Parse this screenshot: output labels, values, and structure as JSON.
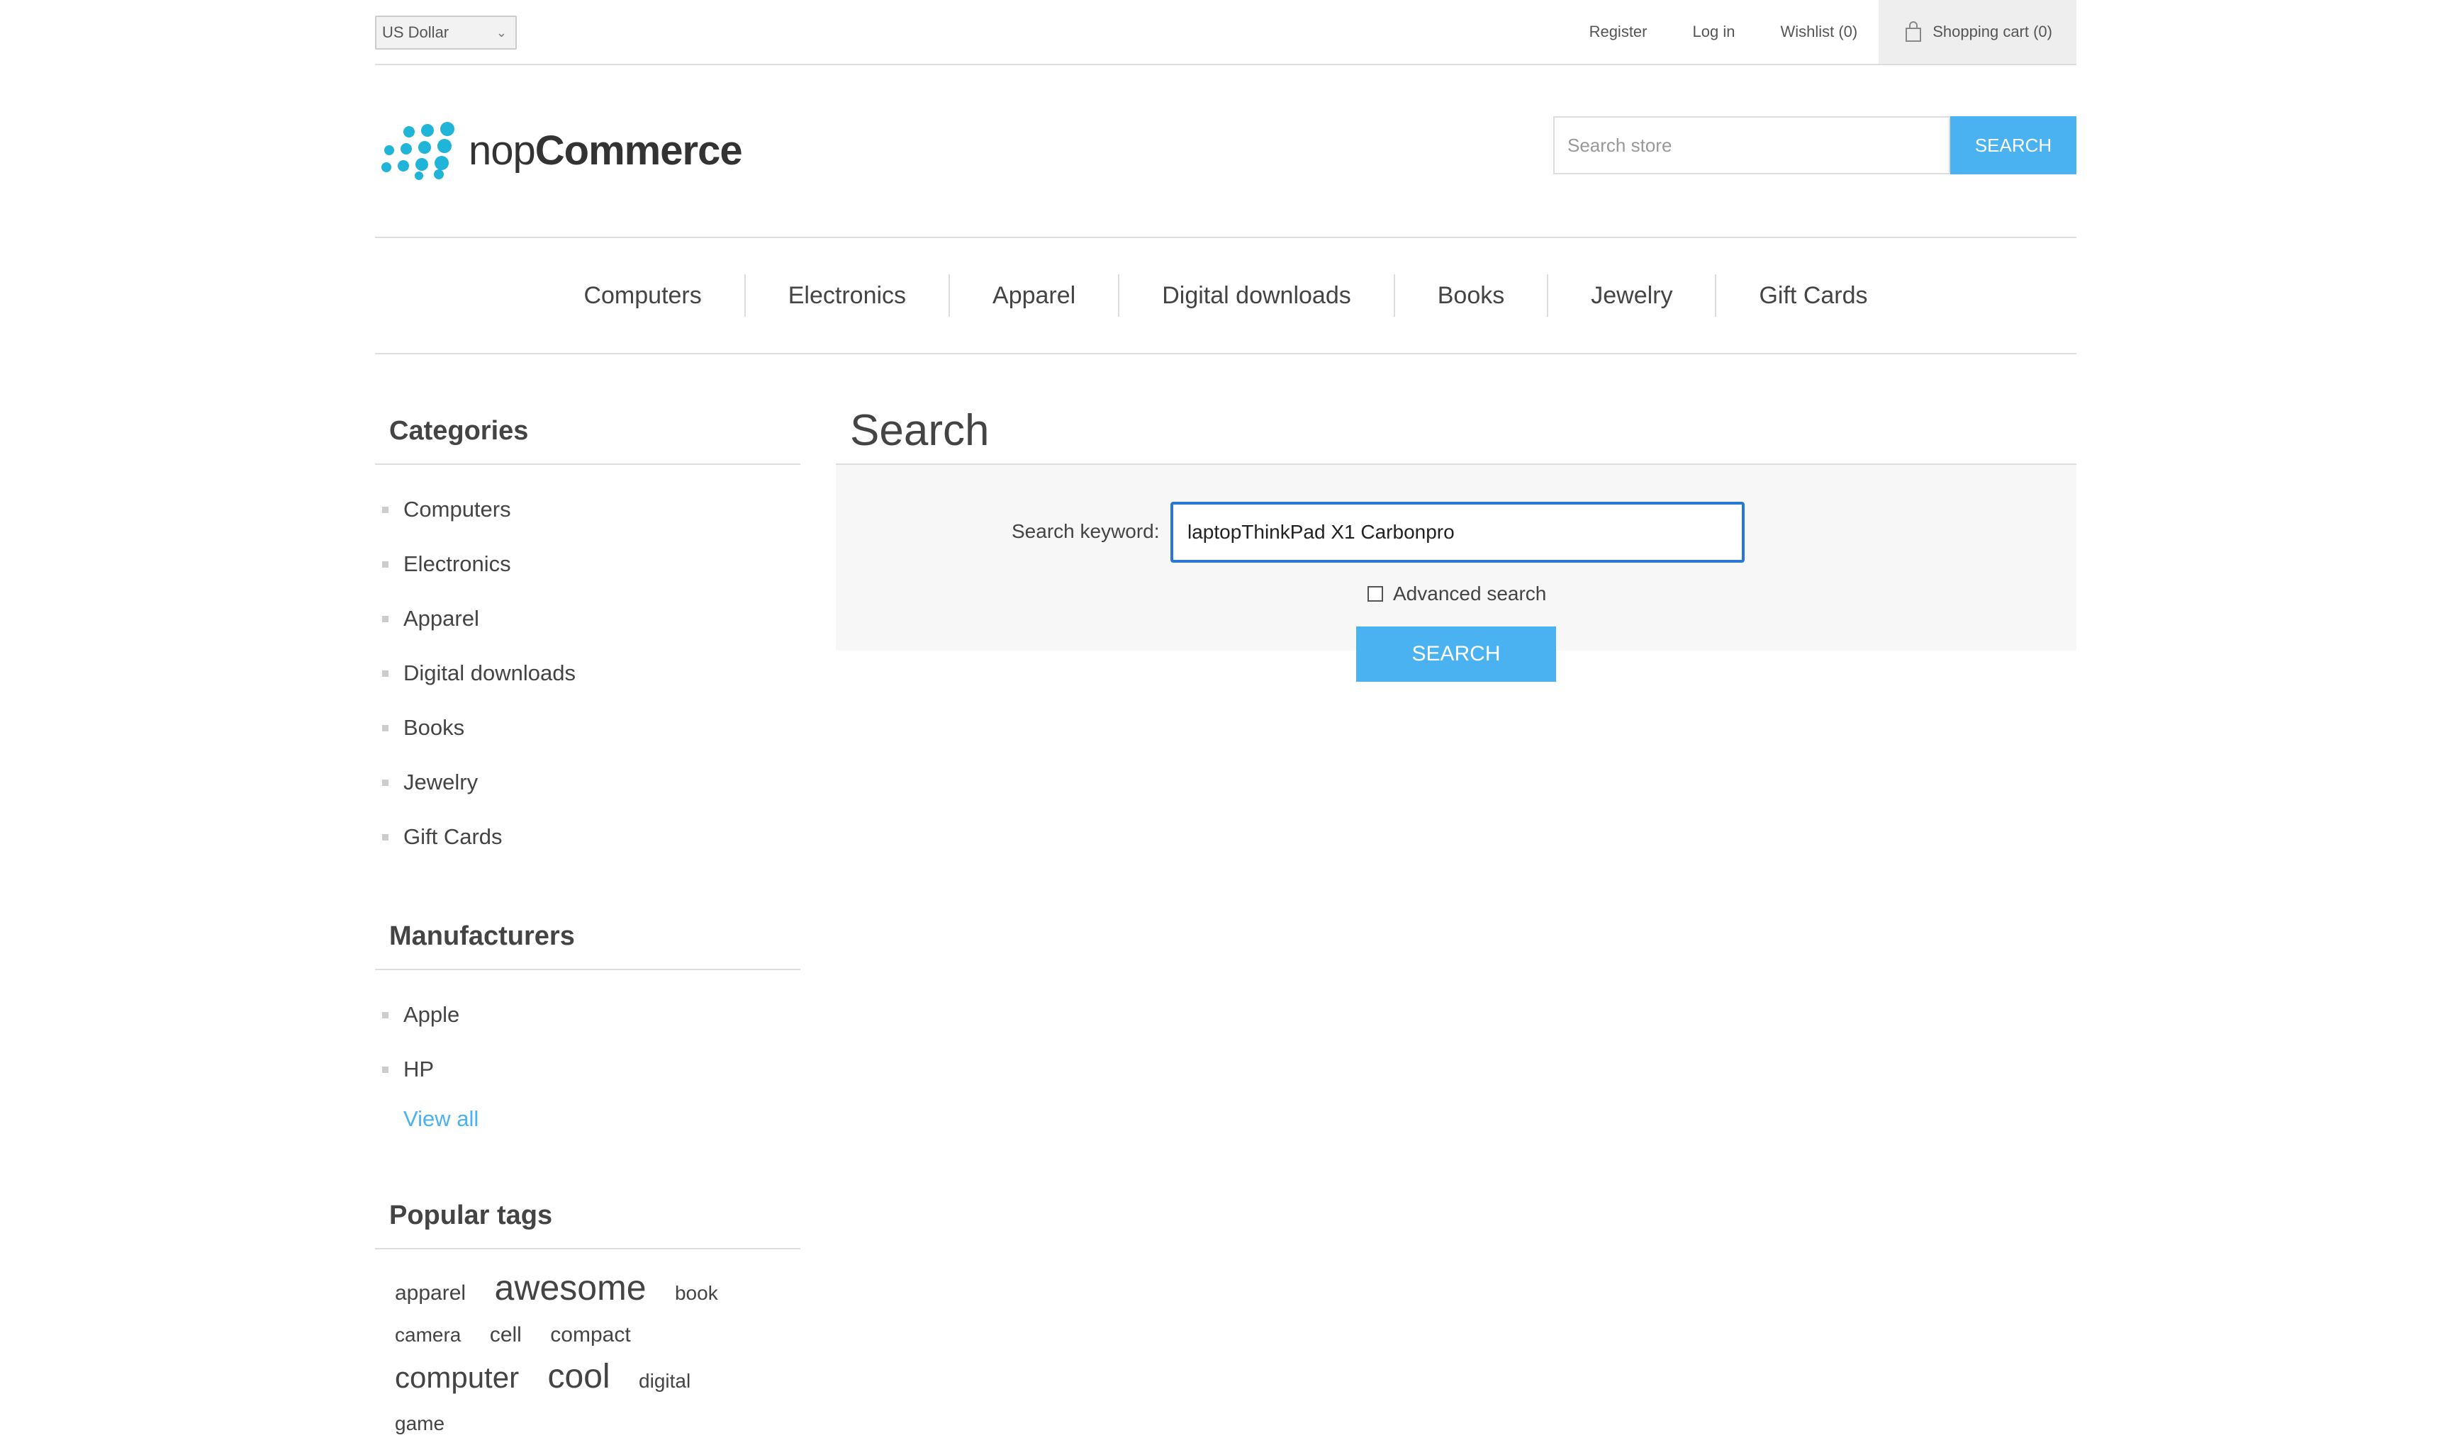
{
  "header": {
    "currency": "US Dollar",
    "links": {
      "register": "Register",
      "login": "Log in",
      "wishlist": "Wishlist (0)",
      "cart": "Shopping cart (0)"
    }
  },
  "logo": {
    "prefix": "nop",
    "suffix": "Commerce"
  },
  "store_search": {
    "placeholder": "Search store",
    "button": "SEARCH"
  },
  "top_menu": [
    "Computers",
    "Electronics",
    "Apparel",
    "Digital downloads",
    "Books",
    "Jewelry",
    "Gift Cards"
  ],
  "sidebar": {
    "categories": {
      "title": "Categories",
      "items": [
        "Computers",
        "Electronics",
        "Apparel",
        "Digital downloads",
        "Books",
        "Jewelry",
        "Gift Cards"
      ]
    },
    "manufacturers": {
      "title": "Manufacturers",
      "items": [
        "Apple",
        "HP"
      ],
      "view_all": "View all"
    },
    "popular_tags": {
      "title": "Popular tags",
      "tags": [
        "apparel",
        "awesome",
        "book",
        "camera",
        "cell",
        "compact",
        "computer",
        "cool",
        "digital",
        "game"
      ]
    }
  },
  "main": {
    "title": "Search",
    "keyword_label": "Search keyword:",
    "keyword_value": "laptopThinkPad X1 Carbonpro",
    "advanced_label": "Advanced search",
    "search_button": "SEARCH"
  },
  "colors": {
    "accent": "#4ab2f1",
    "focus": "#2878d4"
  }
}
